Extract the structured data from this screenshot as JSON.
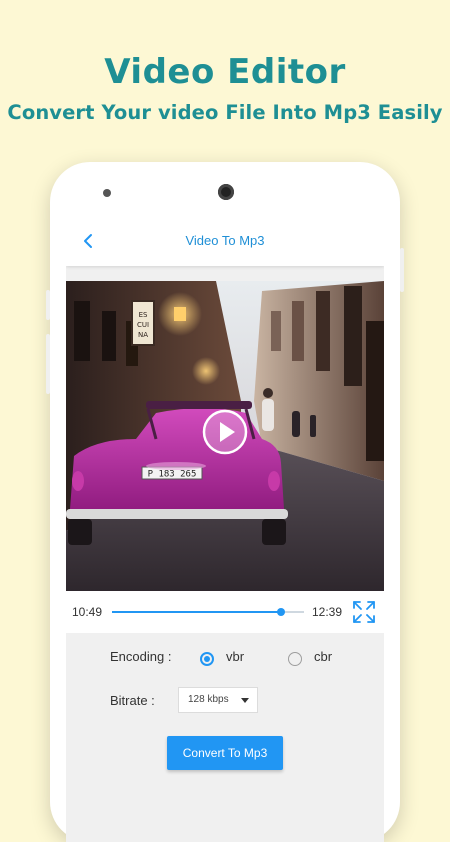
{
  "promo": {
    "title": "Video Editor",
    "subtitle": "Convert Your video File Into Mp3 Easily"
  },
  "app": {
    "title": "Video To Mp3",
    "back_icon": "chevron-left-icon",
    "accent": "#2196f3"
  },
  "video": {
    "plate_text": "P 183 265",
    "sign_text": "ES CUI NA",
    "play_icon": "play-icon"
  },
  "player": {
    "current_time": "10:49",
    "total_time": "12:39",
    "progress": 0.88,
    "fullscreen_icon": "fullscreen-icon"
  },
  "encoding": {
    "label": "Encoding :",
    "options": [
      {
        "label": "vbr",
        "selected": true
      },
      {
        "label": "cbr",
        "selected": false
      }
    ]
  },
  "bitrate": {
    "label": "Bitrate :",
    "selected": "128 kbps"
  },
  "convert_button": "Convert To Mp3",
  "colors": {
    "background": "#fdf8d4",
    "headline": "#1e8f94",
    "car": "#b5259e"
  }
}
